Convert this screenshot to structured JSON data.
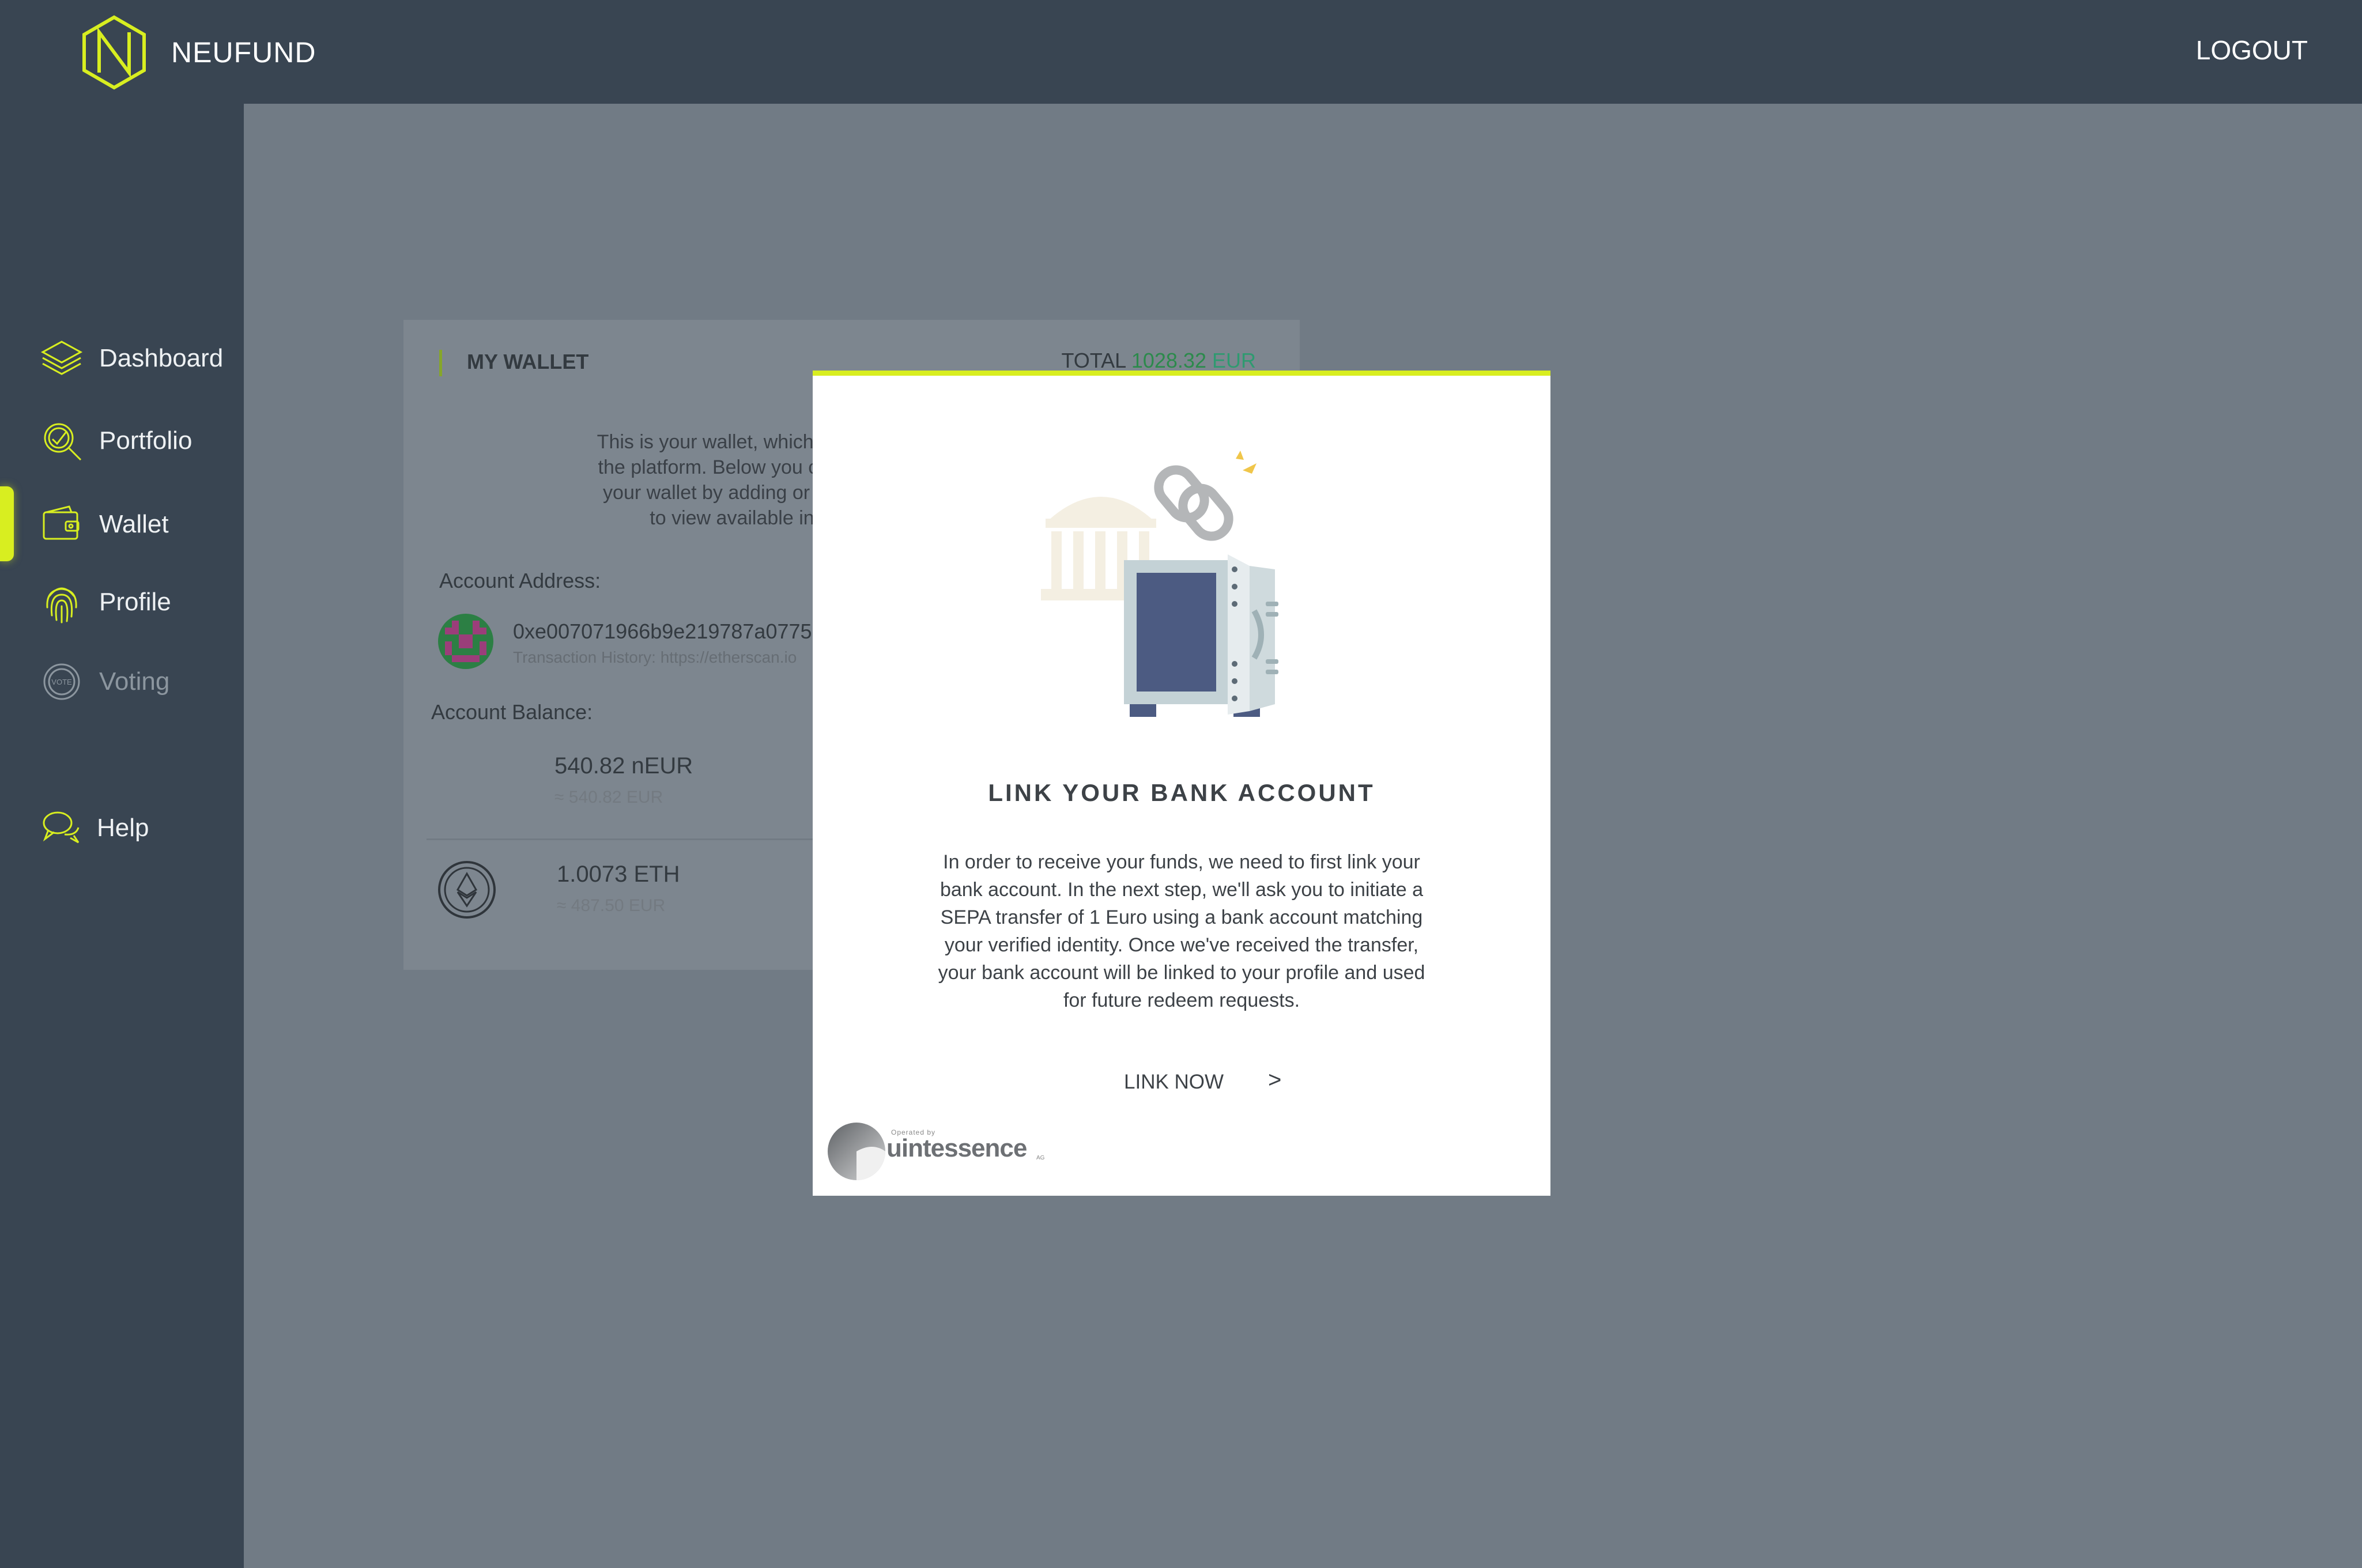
{
  "header": {
    "brand": "NEUFUND",
    "logout_label": "LOGOUT"
  },
  "sidebar": {
    "items": [
      {
        "label": "Dashboard",
        "icon": "layers-icon"
      },
      {
        "label": "Portfolio",
        "icon": "portfolio-magnifier-icon"
      },
      {
        "label": "Wallet",
        "icon": "wallet-icon",
        "active": true
      },
      {
        "label": "Profile",
        "icon": "fingerprint-icon"
      },
      {
        "label": "Voting",
        "icon": "vote-badge-icon",
        "disabled": true
      },
      {
        "label": "Help",
        "icon": "chat-bubbles-icon"
      }
    ]
  },
  "wallet": {
    "title": "MY WALLET",
    "total_label": "TOTAL",
    "total_value": "1028.32",
    "total_currency": "EUR",
    "description": "This is your wallet, which you n\nthe platform. Below you can se\nyour wallet by adding or withd\nto view available in",
    "address_label": "Account Address:",
    "address": "0xe007071966b9e219787a0775",
    "tx_history": "Transaction History: https://etherscan.io",
    "balance_label": "Account Balance:",
    "neur_amount": "540.82 nEUR",
    "neur_eur": "≈ 540.82 EUR",
    "eth_amount": "1.0073 ETH",
    "eth_eur": "≈ 487.50 EUR"
  },
  "modal": {
    "title": "LINK YOUR BANK ACCOUNT",
    "body": "In order to receive your funds, we need to first link your\nbank account. In the next step, we'll ask you to initiate a\nSEPA transfer of 1 Euro using a bank account matching\nyour verified identity. Once we've received the transfer,\nyour bank account will be linked to your profile and used\nfor future redeem requests.",
    "cta": "LINK NOW",
    "cta_arrow": ">",
    "operated_by": "Operated by",
    "operator": "uintessence",
    "operator_suffix": "AG"
  },
  "colors": {
    "accent": "#d8ee20",
    "sidebar_bg": "#394552",
    "overlay_bg": "#717b85",
    "modal_text": "#3d4247"
  }
}
